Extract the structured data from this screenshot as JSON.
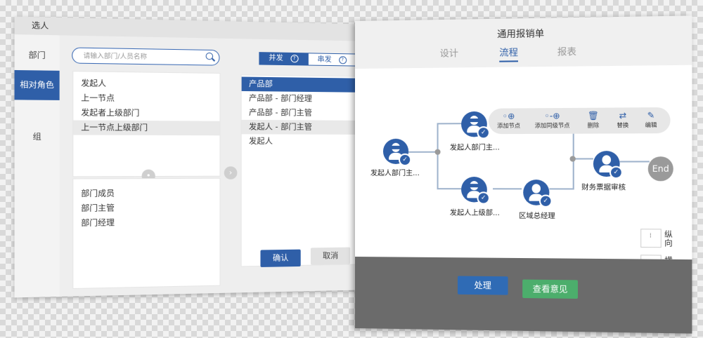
{
  "picker": {
    "title": "选人",
    "side_items": [
      "部门",
      "相对角色",
      "组"
    ],
    "search_placeholder": "请输入部门/人员名称",
    "mode_parallel": "并发",
    "mode_serial": "串发",
    "list_top": [
      "发起人",
      "上一节点",
      "发起者上级部门",
      "上一节点上级部门"
    ],
    "list_bottom": [
      "部门成员",
      "部门主管",
      "部门经理"
    ],
    "selected": [
      "产品部",
      "产品部 - 部门经理",
      "产品部 - 部门主管",
      "发起人 - 部门主管",
      "发起人"
    ],
    "confirm_label": "确认",
    "cancel_label": "取消"
  },
  "flow": {
    "title": "通用报销单",
    "tabs": [
      "设计",
      "流程",
      "报表"
    ],
    "active_tab": "流程",
    "nodes": {
      "start": "发起人部门主...",
      "top": "发起人部门主...",
      "bottom": "发起人上级部...",
      "region": "区域总经理",
      "finance": "财务票据审核",
      "end": "End"
    },
    "toolbar": {
      "add_node": "添加节点",
      "add_sibling": "添加同级节点",
      "delete": "删除",
      "replace": "替换",
      "edit": "编辑"
    },
    "orientation": {
      "vertical": "纵向",
      "horizontal": "横向"
    },
    "process_label": "处理",
    "view_opinion_label": "查看意见"
  },
  "colors": {
    "accent": "#2f5fa8",
    "green": "#4cae6c",
    "footer": "#6b6b6b"
  }
}
